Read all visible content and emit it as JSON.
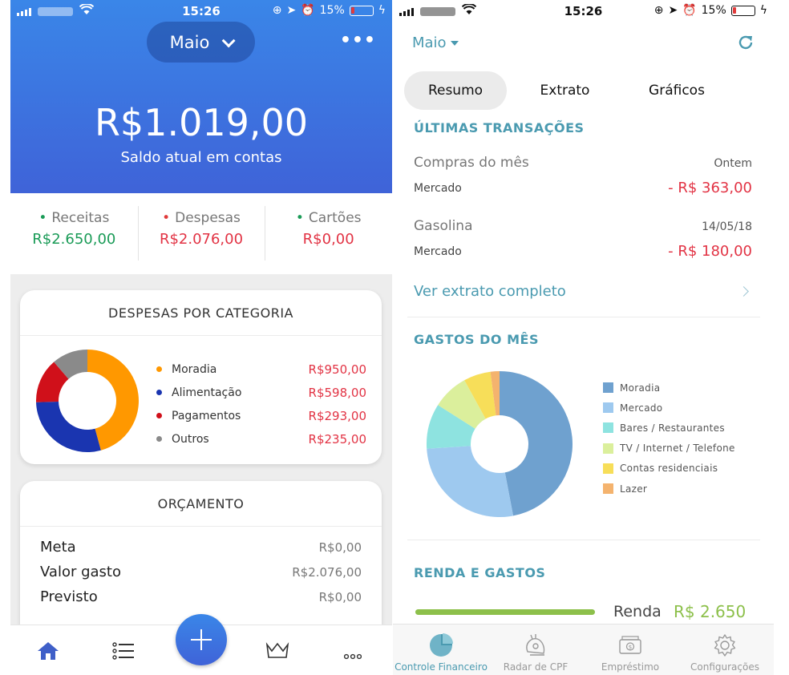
{
  "left": {
    "status": {
      "time": "15:26",
      "battery": "15%"
    },
    "header": {
      "month": "Maio",
      "balance": "R$1.019,00",
      "balance_label": "Saldo atual em contas"
    },
    "summary": [
      {
        "label": "Receitas",
        "value": "R$2.650,00",
        "color": "#1a9b57"
      },
      {
        "label": "Despesas",
        "value": "R$2.076,00",
        "color": "#e23344"
      },
      {
        "label": "Cartões",
        "value": "R$0,00",
        "color": "#e23344"
      }
    ],
    "categories": {
      "title": "DESPESAS POR CATEGORIA",
      "items": [
        {
          "name": "Moradia",
          "amount": "R$950,00",
          "value": 950,
          "color": "#ff9800"
        },
        {
          "name": "Alimentação",
          "amount": "R$598,00",
          "value": 598,
          "color": "#1a35b0"
        },
        {
          "name": "Pagamentos",
          "amount": "R$293,00",
          "value": 293,
          "color": "#d0101a"
        },
        {
          "name": "Outros",
          "amount": "R$235,00",
          "value": 235,
          "color": "#8a8a8a"
        }
      ]
    },
    "budget": {
      "title": "ORÇAMENTO",
      "rows": [
        {
          "label": "Meta",
          "value": "R$0,00"
        },
        {
          "label": "Valor gasto",
          "value": "R$2.076,00"
        },
        {
          "label": "Previsto",
          "value": "R$0,00"
        }
      ]
    },
    "tabbar": [
      "home-icon",
      "list-icon",
      "add-icon",
      "crown-icon",
      "more-icon"
    ]
  },
  "right": {
    "status": {
      "time": "15:26",
      "battery": "15%"
    },
    "header": {
      "month": "Maio"
    },
    "tabs": [
      {
        "label": "Resumo",
        "active": true
      },
      {
        "label": "Extrato",
        "active": false
      },
      {
        "label": "Gráficos",
        "active": false
      }
    ],
    "transactions": {
      "title": "ÚLTIMAS TRANSAÇÕES",
      "items": [
        {
          "name": "Compras do mês",
          "date": "Ontem",
          "category": "Mercado",
          "amount": "- R$ 363,00"
        },
        {
          "name": "Gasolina",
          "date": "14/05/18",
          "category": "Mercado",
          "amount": "- R$ 180,00"
        }
      ],
      "link": "Ver extrato completo"
    },
    "spending": {
      "title": "GASTOS DO MÊS",
      "items": [
        {
          "name": "Moradia",
          "value": 47,
          "color": "#6fa1cf"
        },
        {
          "name": "Mercado",
          "value": 27,
          "color": "#9ec9ef"
        },
        {
          "name": "Bares / Restaurantes",
          "value": 10,
          "color": "#8ee3e0"
        },
        {
          "name": "TV / Internet / Telefone",
          "value": 8,
          "color": "#dbef9c"
        },
        {
          "name": "Contas residenciais",
          "value": 6,
          "color": "#f7de59"
        },
        {
          "name": "Lazer",
          "value": 2,
          "color": "#f4b36e"
        }
      ]
    },
    "income": {
      "title": "RENDA E GASTOS",
      "label": "Renda",
      "value": "R$ 2.650"
    },
    "tabbar": [
      {
        "label": "Controle Financeiro",
        "icon": "pie-chart-icon",
        "active": true
      },
      {
        "label": "Radar de CPF",
        "icon": "radar-icon",
        "active": false
      },
      {
        "label": "Empréstimo",
        "icon": "money-icon",
        "active": false
      },
      {
        "label": "Configurações",
        "icon": "gear-icon",
        "active": false
      }
    ]
  }
}
